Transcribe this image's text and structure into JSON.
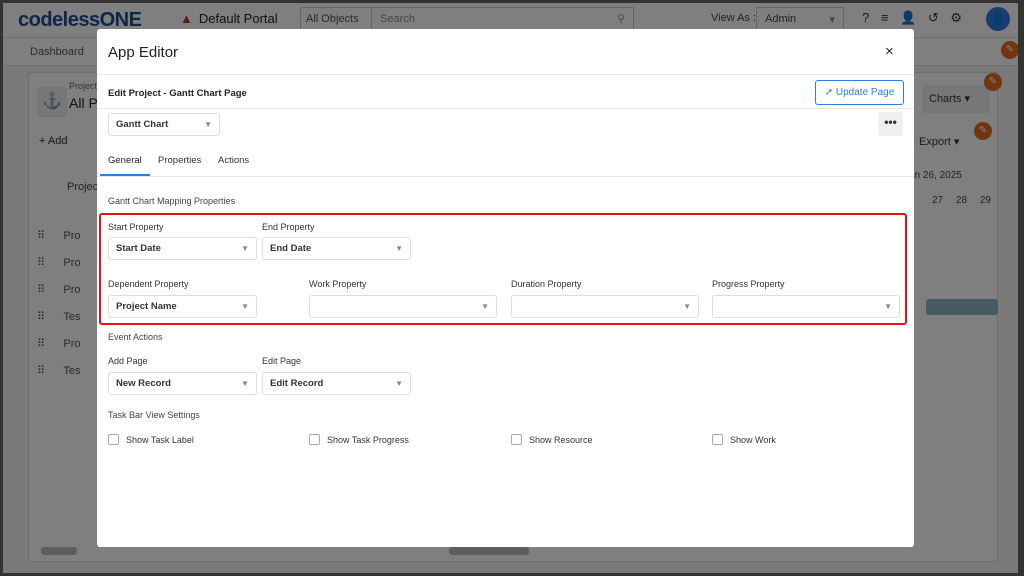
{
  "topbar": {
    "logo": "codelessONE",
    "portal": "Default Portal",
    "objects": "All Objects",
    "search_placeholder": "Search",
    "view_as_label": "View As :",
    "view_as_value": "Admin"
  },
  "nav": {
    "dashboard": "Dashboard"
  },
  "background": {
    "page_subtitle": "Project",
    "page_title": "All P",
    "add": "+ Add",
    "charts": "Charts",
    "export": "Export",
    "col_header": "Projec",
    "date_header": "an 26, 2025",
    "days": [
      "27",
      "28",
      "29"
    ],
    "rows": [
      "Pro",
      "Pro",
      "Pro",
      "Tes",
      "Pro",
      "Tes"
    ]
  },
  "modal": {
    "title": "App Editor",
    "close": "×",
    "edit_line": "Edit  Project  -  Gantt Chart  Page",
    "update_button": "Update Page",
    "page_select": "Gantt Chart",
    "more": "•••",
    "tabs": [
      "General",
      "Properties",
      "Actions"
    ],
    "active_tab": "General",
    "mapping_title": "Gantt Chart Mapping Properties",
    "fields": {
      "start": {
        "label": "Start Property",
        "value": "Start Date"
      },
      "end": {
        "label": "End Property",
        "value": "End Date"
      },
      "dependent": {
        "label": "Dependent Property",
        "value": "Project Name"
      },
      "work": {
        "label": "Work Property",
        "value": ""
      },
      "duration": {
        "label": "Duration Property",
        "value": ""
      },
      "progress": {
        "label": "Progress Property",
        "value": ""
      }
    },
    "event_title": "Event Actions",
    "add_page": {
      "label": "Add Page",
      "value": "New Record"
    },
    "edit_page": {
      "label": "Edit Page",
      "value": "Edit Record"
    },
    "taskbar_title": "Task Bar View Settings",
    "checkboxes": [
      {
        "label": "Show Task Label",
        "checked": false
      },
      {
        "label": "Show Task Progress",
        "checked": false
      },
      {
        "label": "Show Resource",
        "checked": false
      },
      {
        "label": "Show Work",
        "checked": false
      }
    ]
  },
  "colors": {
    "accent": "#2f7de1",
    "highlight": "#e3121b",
    "edit_badge": "#e26b1f"
  }
}
